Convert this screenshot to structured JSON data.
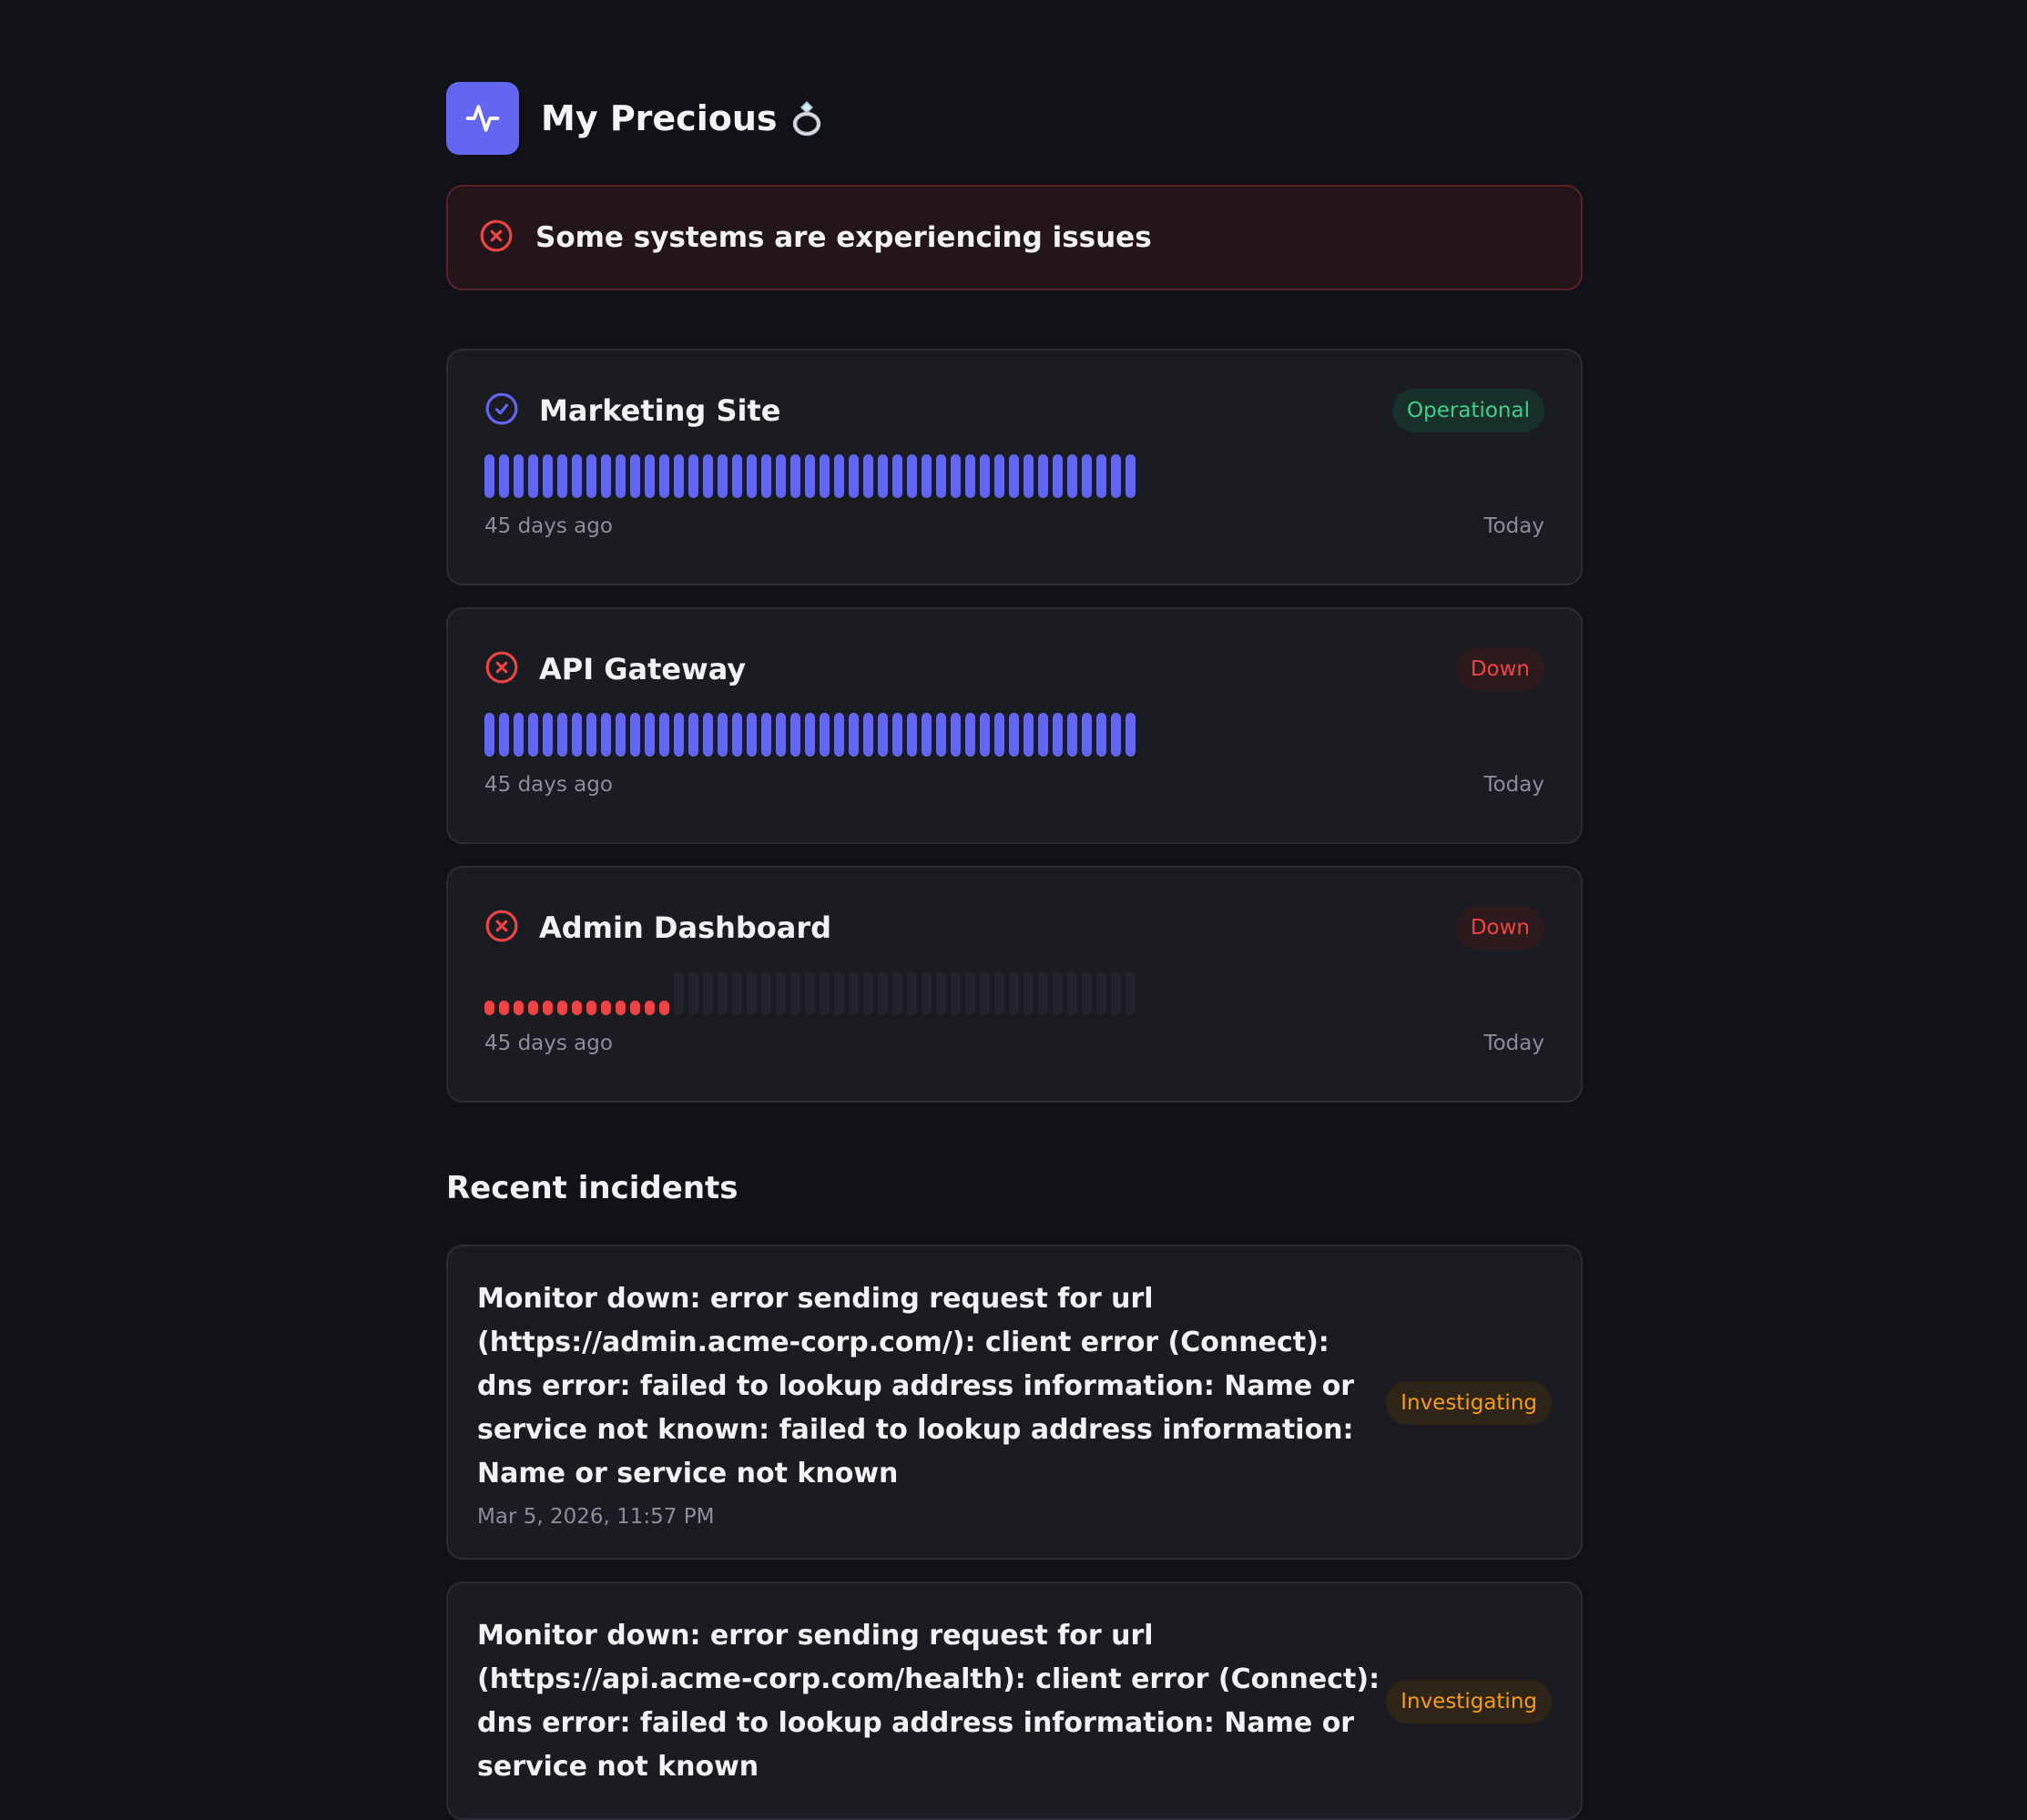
{
  "site": {
    "title": "My Precious"
  },
  "banner": {
    "text": "Some systems are experiencing issues"
  },
  "monitors": [
    {
      "name": "Marketing Site",
      "status": "Operational",
      "uptime_bar": {
        "days": 45,
        "up_days": 45,
        "down_days": 0,
        "no_data_days": 0
      },
      "start_label": "45 days ago",
      "end_label": "Today"
    },
    {
      "name": "API Gateway",
      "status": "Down",
      "uptime_bar": {
        "days": 45,
        "up_days": 45,
        "down_days": 0,
        "no_data_days": 0
      },
      "start_label": "45 days ago",
      "end_label": "Today"
    },
    {
      "name": "Admin Dashboard",
      "status": "Down",
      "uptime_bar": {
        "days": 45,
        "up_days": 0,
        "down_days": 13,
        "no_data_days": 32
      },
      "start_label": "45 days ago",
      "end_label": "Today"
    }
  ],
  "incidents_section": {
    "title": "Recent incidents"
  },
  "incidents": [
    {
      "message": "Monitor down: error sending request for url (https://admin.acme-corp.com/): client error (Connect): dns error: failed to lookup address information: Name or service not known: failed to lookup address information: Name or service not known",
      "status": "Investigating",
      "time": "Mar 5, 2026, 11:57 PM"
    },
    {
      "message": "Monitor down: error sending request for url (https://api.acme-corp.com/health): client error (Connect): dns error: failed to lookup address information: Name or service not known",
      "status": "Investigating",
      "time": ""
    }
  ],
  "colors": {
    "accent": "#6366f1",
    "operational": "#3ecf8e",
    "down": "#ef4444",
    "investigating": "#f59e0b",
    "background": "#111217",
    "card": "#1b1c22"
  },
  "icons": {
    "logo": "activity-pulse-icon",
    "ring": "ring-emoji-icon",
    "operational": "check-circle-icon",
    "down": "x-circle-icon"
  }
}
